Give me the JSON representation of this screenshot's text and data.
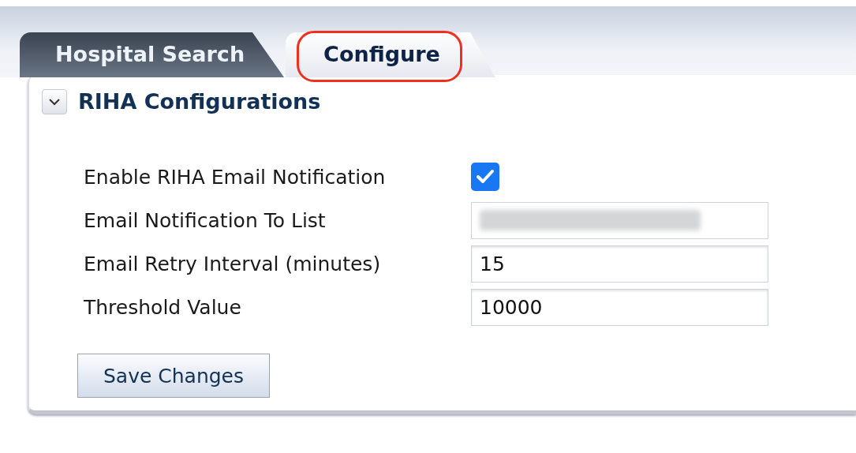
{
  "tabs": [
    {
      "label": "Hospital Search",
      "selected": false,
      "highlighted": false
    },
    {
      "label": "Configure",
      "selected": true,
      "highlighted": true
    }
  ],
  "section": {
    "title": "RIHA Configurations",
    "expanded": true
  },
  "fields": [
    {
      "kind": "checkbox",
      "label": "Enable RIHA Email Notification",
      "checked": true
    },
    {
      "kind": "redacted",
      "label": "Email Notification To List"
    },
    {
      "kind": "text",
      "label": "Email Retry Interval (minutes)",
      "value": "15"
    },
    {
      "kind": "text",
      "label": "Threshold Value",
      "value": "10000"
    }
  ],
  "save_button": "Save Changes"
}
